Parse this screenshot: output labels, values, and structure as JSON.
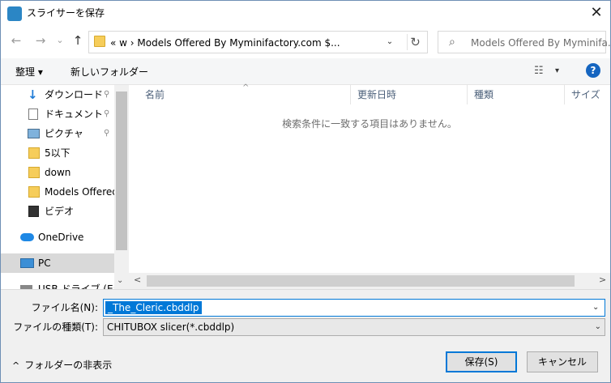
{
  "window": {
    "title": "スライサーを保存",
    "close_glyph": "✕"
  },
  "nav": {
    "back_glyph": "←",
    "forward_glyph": "→",
    "recent_glyph": "⌄",
    "up_glyph": "↑",
    "address_text": "«  w  ›  Models Offered By Myminifactory.com $...",
    "address_drop_glyph": "⌄",
    "refresh_glyph": "↻",
    "search_placeholder": "Models Offered By Myminifa..."
  },
  "toolbar": {
    "organize": "整理 ▾",
    "new_folder": "新しいフォルダー",
    "view_glyph": "☷",
    "view_drop_glyph": "▾",
    "help_glyph": "?"
  },
  "sidebar": {
    "items": [
      {
        "label": "ダウンロード",
        "icon": "download-icon",
        "pinned": true
      },
      {
        "label": "ドキュメント",
        "icon": "document-icon",
        "pinned": true
      },
      {
        "label": "ピクチャ",
        "icon": "pictures-icon",
        "pinned": true
      },
      {
        "label": "5以下",
        "icon": "folder-icon"
      },
      {
        "label": "down",
        "icon": "folder-icon"
      },
      {
        "label": "Models Offered",
        "icon": "folder-icon"
      },
      {
        "label": "ビデオ",
        "icon": "video-icon"
      },
      {
        "label": "OneDrive",
        "icon": "onedrive-icon"
      },
      {
        "label": "PC",
        "icon": "pc-icon"
      },
      {
        "label": "USB ドライブ (E:)",
        "icon": "usb-drive-icon"
      }
    ],
    "pin_glyph": "📌",
    "scroll_down_glyph": "⌄"
  },
  "files": {
    "columns": [
      "名前",
      "更新日時",
      "種類",
      "サイズ"
    ],
    "sort_glyph": "^",
    "empty_message": "検索条件に一致する項目はありません。",
    "scroll_left_glyph": "<",
    "scroll_right_glyph": ">"
  },
  "form": {
    "filename_label": "ファイル名(N):",
    "filename_value": "_The_Cleric.cbddlp",
    "filetype_label": "ファイルの種類(T):",
    "filetype_value": "CHITUBOX slicer(*.cbddlp)",
    "drop_glyph": "⌄",
    "hide_folders": "フォルダーの非表示",
    "hide_glyph": "^",
    "save_button": "保存(S)",
    "cancel_button": "キャンセル"
  },
  "colors": {
    "accent": "#0078d7",
    "selection": "#cce8ff",
    "help": "#1565c0",
    "folder": "#f6cd5a"
  }
}
